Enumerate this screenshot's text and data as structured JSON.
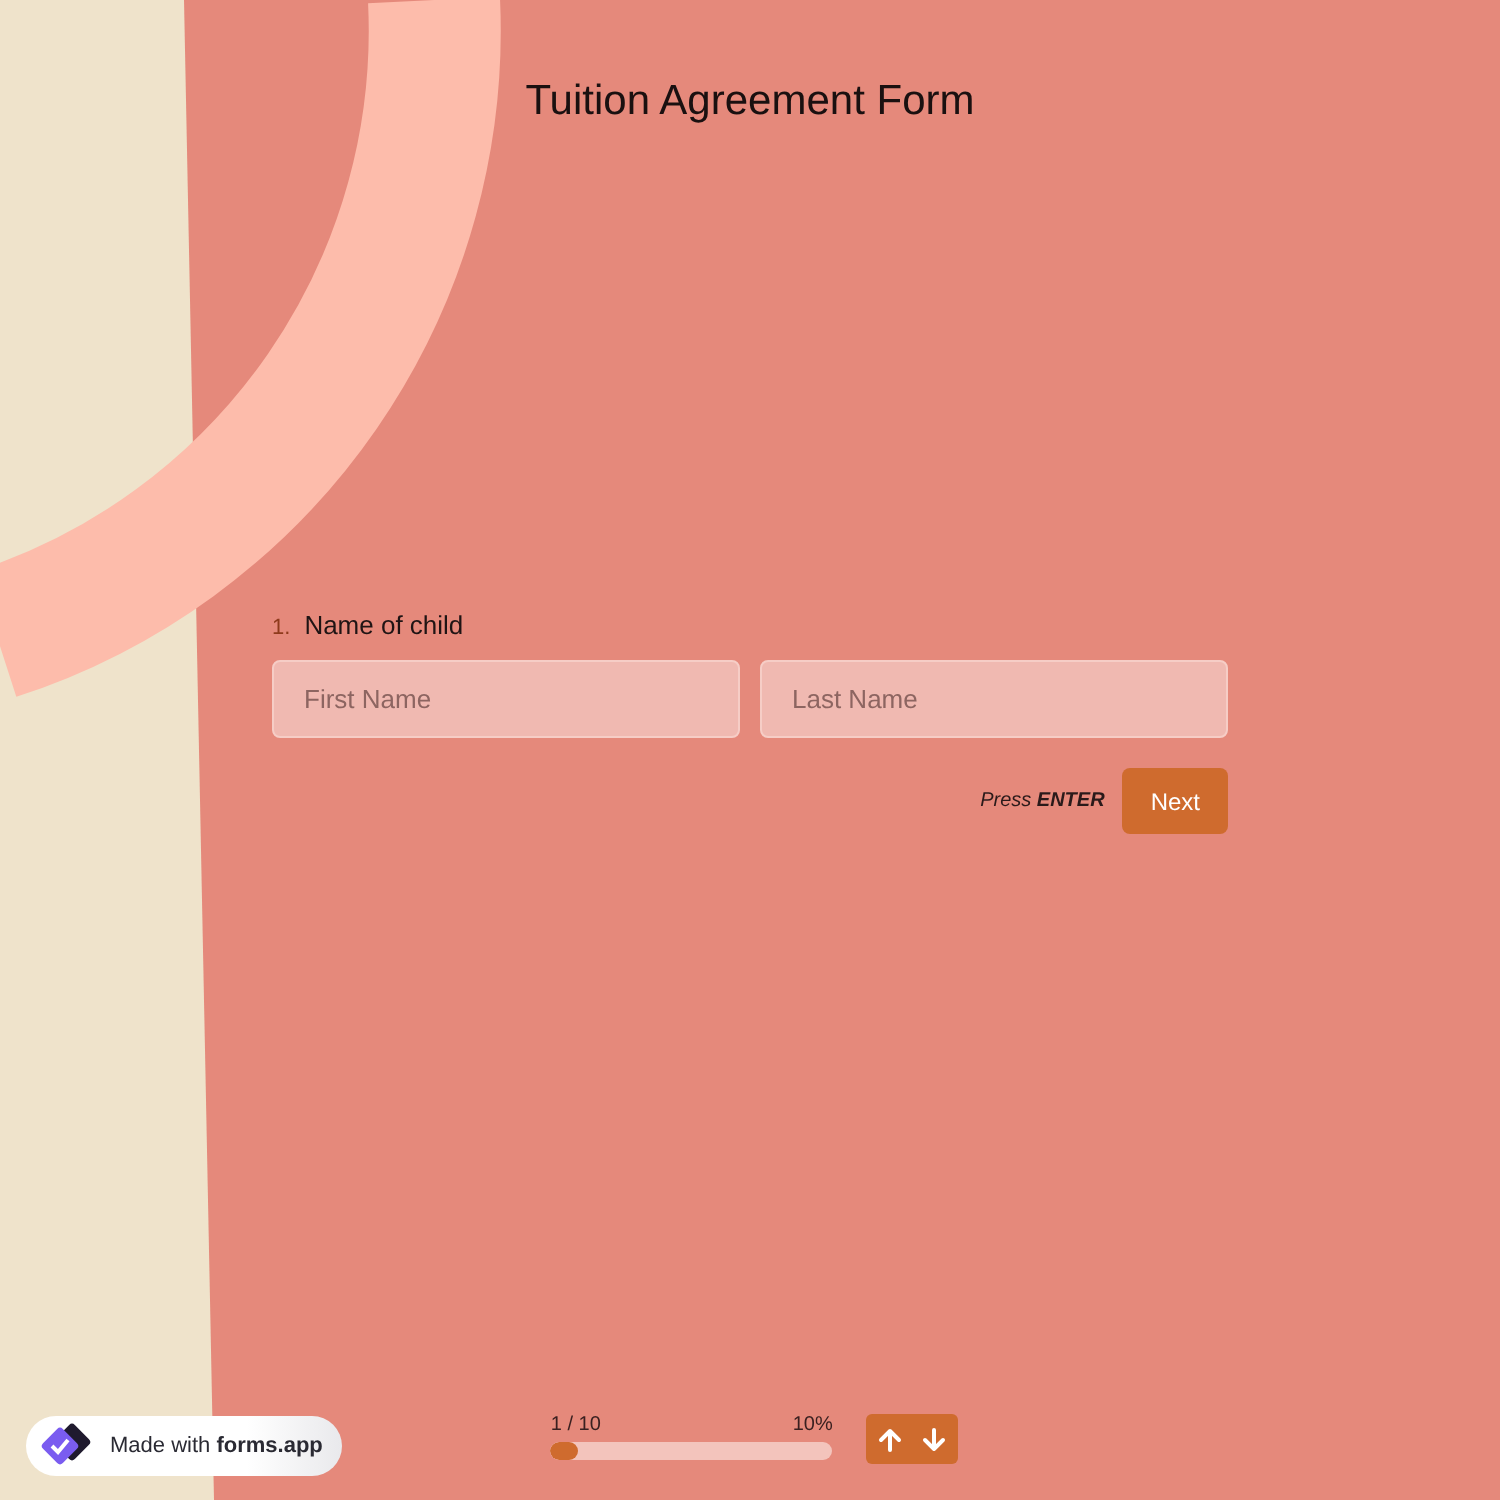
{
  "page": {
    "title": "Tuition Agreement Form"
  },
  "question": {
    "number": "1.",
    "label": "Name of child",
    "fields": [
      {
        "placeholder": "First Name"
      },
      {
        "placeholder": "Last Name"
      }
    ]
  },
  "submit": {
    "hint": "Press **ENTER**",
    "button": "Next"
  },
  "badge": {
    "text": "Made with **forms.app**"
  },
  "progress": {
    "counter": "1 / 10",
    "percent": "10%",
    "level": 0.1
  }
}
